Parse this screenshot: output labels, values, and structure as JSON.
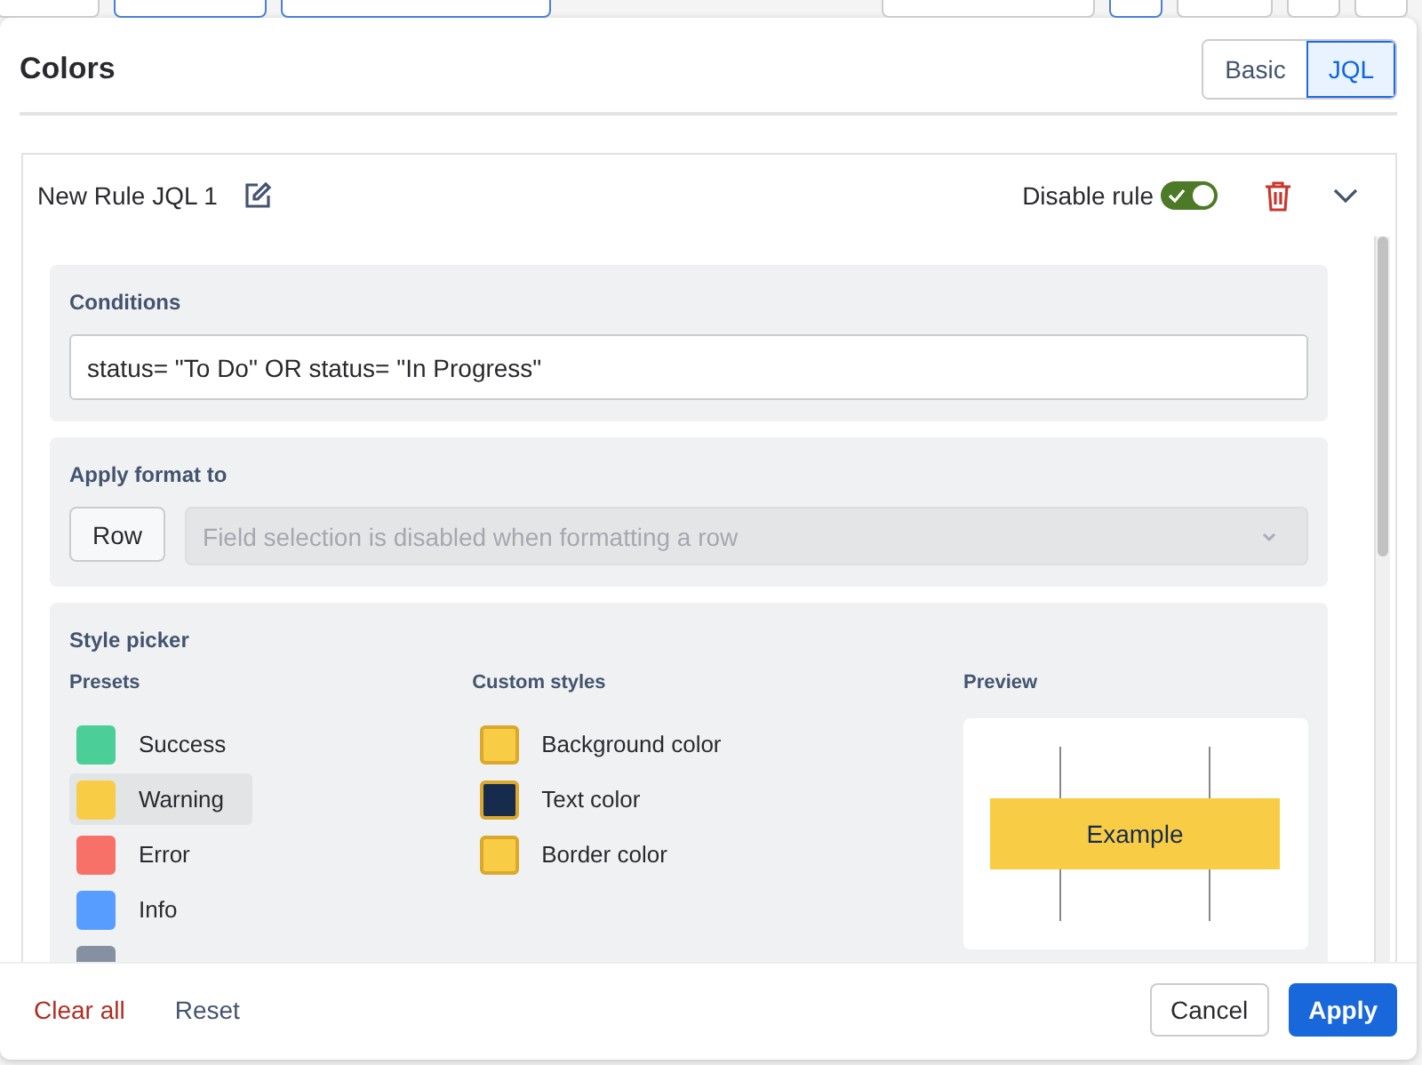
{
  "dialog": {
    "title": "Colors",
    "mode_tabs": [
      {
        "label": "Basic",
        "selected": false
      },
      {
        "label": "JQL",
        "selected": true
      }
    ]
  },
  "rule": {
    "name": "New Rule JQL 1",
    "toggle_label": "Disable rule",
    "toggle_on": true,
    "expanded": true
  },
  "conditions": {
    "heading": "Conditions",
    "value": "status= \"To Do\" OR status= \"In Progress\""
  },
  "apply_format": {
    "heading": "Apply format to",
    "button": "Row",
    "field_placeholder": "Field selection is disabled when formatting a row",
    "field_disabled": true
  },
  "style_picker": {
    "heading": "Style picker",
    "presets_heading": "Presets",
    "presets": [
      {
        "label": "Success",
        "color": "#4bce97",
        "selected": false
      },
      {
        "label": "Warning",
        "color": "#f8cd45",
        "selected": true
      },
      {
        "label": "Error",
        "color": "#f87168",
        "selected": false
      },
      {
        "label": "Info",
        "color": "#579dff",
        "selected": false
      },
      {
        "color": "#8590a2",
        "selected": false
      }
    ],
    "custom_heading": "Custom styles",
    "custom": [
      {
        "label": "Background color",
        "color": "#f8cd45"
      },
      {
        "label": "Text color",
        "color": "#172b4d"
      },
      {
        "label": "Border color",
        "color": "#f8cd45"
      }
    ],
    "preview_heading": "Preview",
    "preview_text": "Example"
  },
  "footer": {
    "clear": "Clear all",
    "reset": "Reset",
    "cancel": "Cancel",
    "apply": "Apply"
  }
}
